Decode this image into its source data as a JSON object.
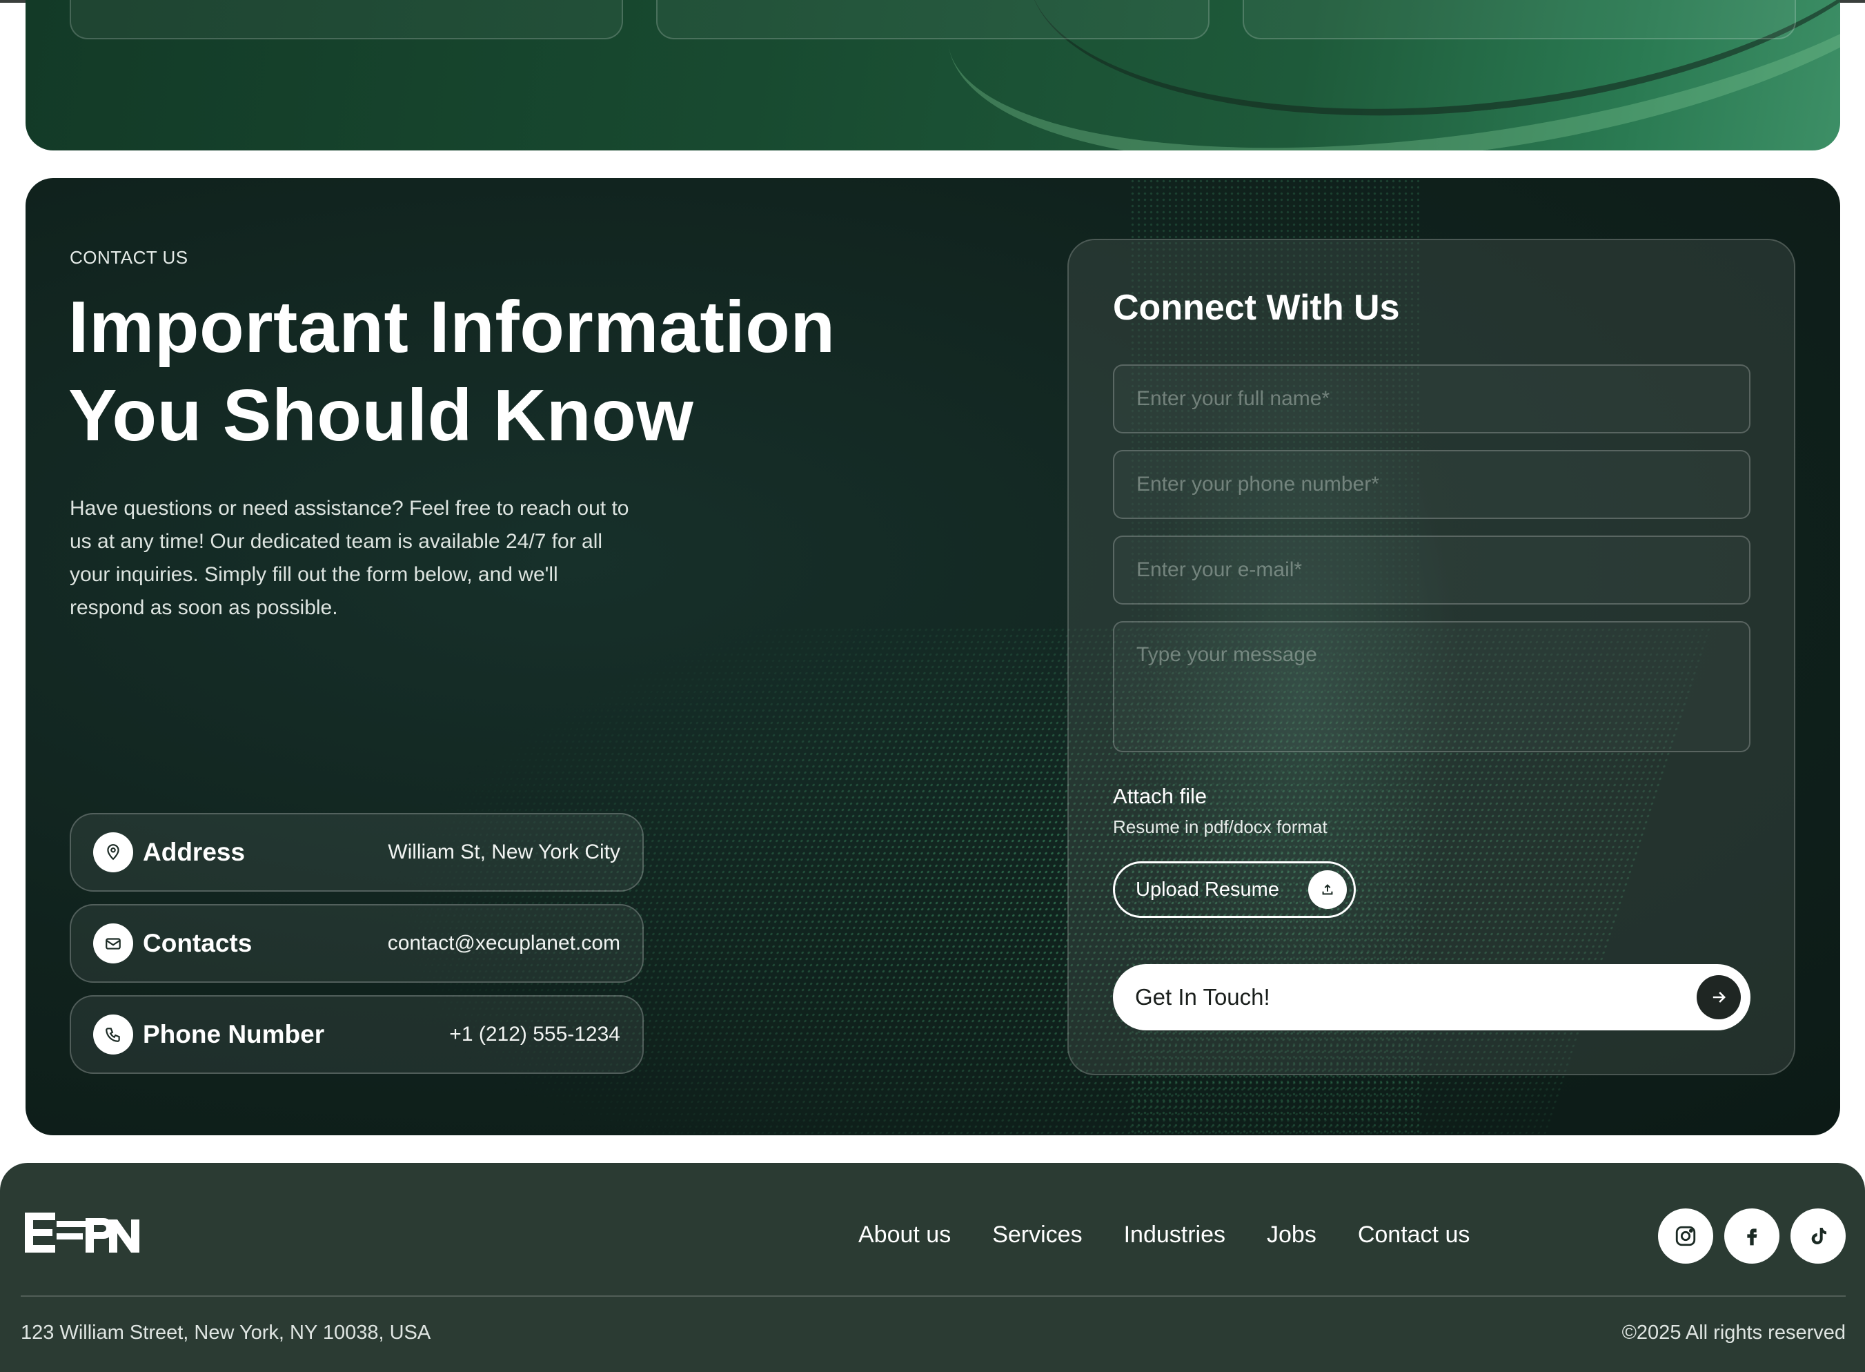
{
  "contact": {
    "eyebrow": "CONTACT US",
    "headline_line1": "Important Information",
    "headline_line2": "You Should Know",
    "intro_line1": "Have questions or need assistance? Feel free to reach out to",
    "intro_line2": "us at any time! Our dedicated team is available 24/7 for all",
    "intro_line3": "your inquiries. Simply fill out the form below, and we'll",
    "intro_line4": "respond as soon as possible.",
    "info": [
      {
        "label": "Address",
        "value": "William St, New York City",
        "icon": "map-pin-icon"
      },
      {
        "label": "Contacts",
        "value": "contact@xecuplanet.com",
        "icon": "mail-icon"
      },
      {
        "label": "Phone Number",
        "value": "+1 (212) 555-1234",
        "icon": "phone-icon"
      }
    ]
  },
  "form": {
    "title": "Connect With Us",
    "name_placeholder": "Enter your full name*",
    "phone_placeholder": "Enter your phone number*",
    "email_placeholder": "Enter your e-mail*",
    "message_placeholder": "Type your message",
    "name_value": "",
    "phone_value": "",
    "email_value": "",
    "message_value": "",
    "attach_title": "Attach file",
    "attach_subtitle": "Resume in pdf/docx format",
    "upload_label": "Upload Resume",
    "submit_label": "Get In Touch!"
  },
  "footer": {
    "nav": [
      "About us",
      "Services",
      "Industries",
      "Jobs",
      "Contact us"
    ],
    "social": [
      "instagram-icon",
      "facebook-icon",
      "tiktok-icon"
    ],
    "address": "123 William Street, New York, NY 10038, USA",
    "copyright": "©2025 All rights reserved"
  },
  "colors": {
    "dark_green_bg": "#10221d",
    "accent_green": "#3d8f66",
    "footer_bg": "#2b3b33",
    "white": "#ffffff"
  }
}
